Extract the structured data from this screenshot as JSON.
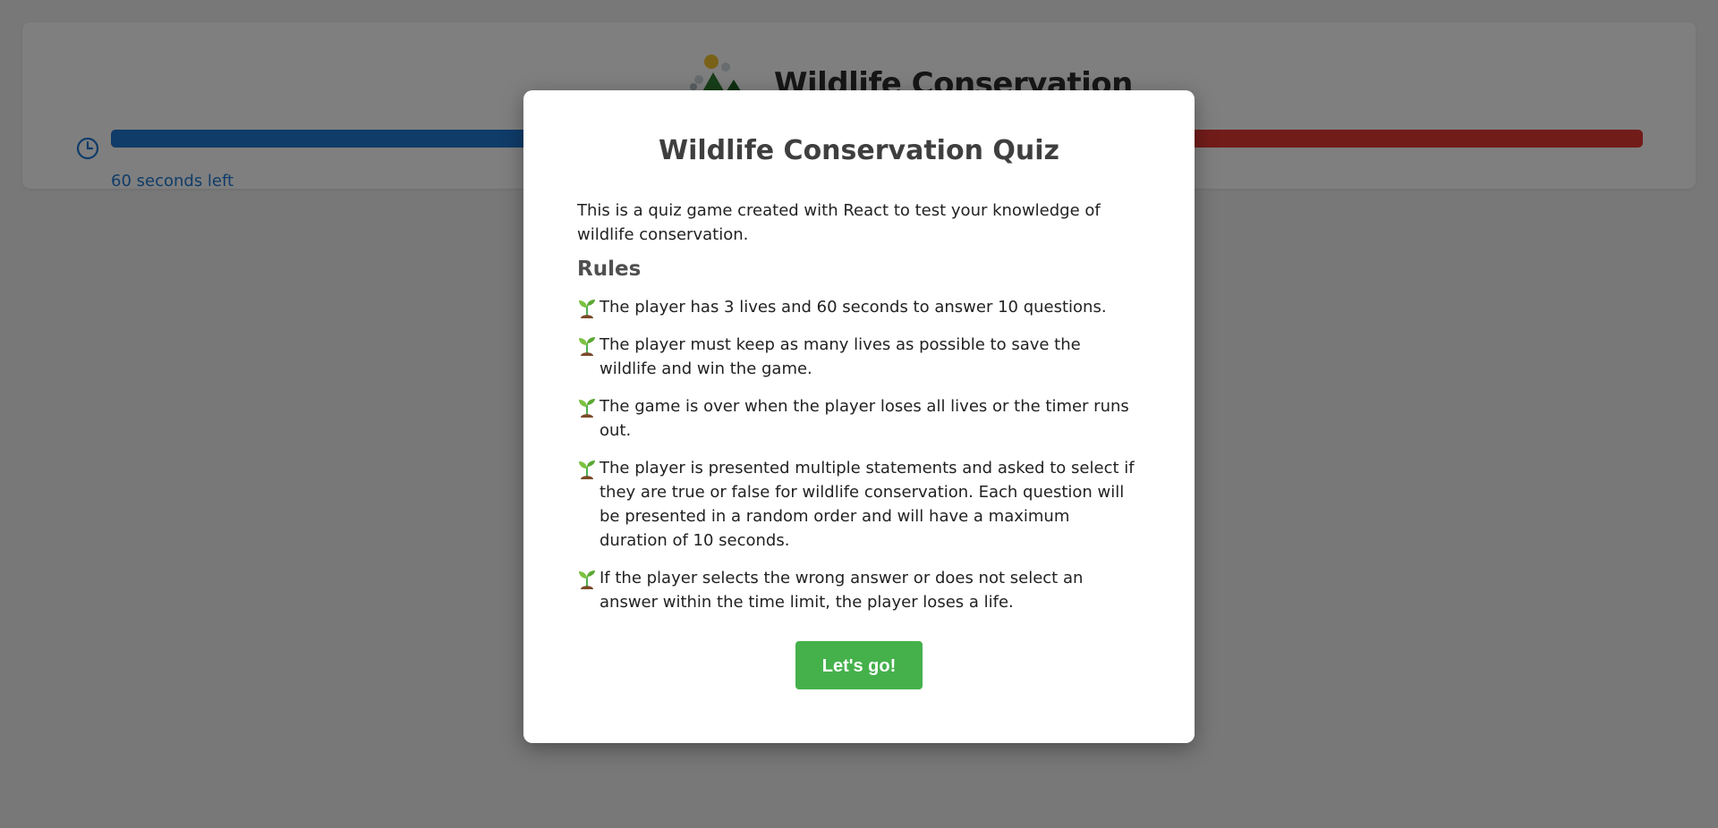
{
  "header": {
    "title": "Wildlife Conservation",
    "logo_icon": "mountain-tree-icon"
  },
  "timer": {
    "icon": "clock-icon",
    "label": "60 seconds left",
    "progress_fraction": 0.5,
    "fill_color": "#1e78d2",
    "remaining_color": "#e53935"
  },
  "modal": {
    "title": "Wildlife Conservation Quiz",
    "intro": "This is a quiz game created with React to test your knowledge of wildlife conservation.",
    "rules_heading": "Rules",
    "rule_icon": "sprout-icon",
    "rules": [
      "The player has 3 lives and 60 seconds to answer 10 questions.",
      "The player must keep as many lives as possible to save the wildlife and win the game.",
      "The game is over when the player loses all lives or the timer runs out.",
      "The player is presented multiple statements and asked to select if they are true or false for wildlife conservation. Each question will be presented in a random order and will have a maximum duration of 10 seconds.",
      "If the player selects the wrong answer or does not select an answer within the time limit, the player loses a life."
    ],
    "start_button": "Let's go!",
    "button_color": "#45b14b"
  }
}
